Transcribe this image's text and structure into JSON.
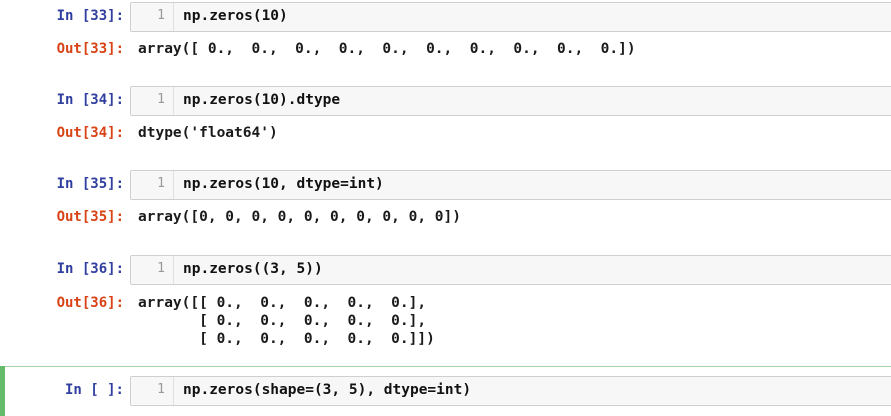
{
  "cells": [
    {
      "in_prompt": "In [33]:",
      "line_number": "1",
      "code": "np.zeros(10)",
      "out_prompt": "Out[33]:",
      "output": "array([ 0.,  0.,  0.,  0.,  0.,  0.,  0.,  0.,  0.,  0.])"
    },
    {
      "in_prompt": "In [34]:",
      "line_number": "1",
      "code": "np.zeros(10).dtype",
      "out_prompt": "Out[34]:",
      "output": "dtype('float64')"
    },
    {
      "in_prompt": "In [35]:",
      "line_number": "1",
      "code": "np.zeros(10, dtype=int)",
      "out_prompt": "Out[35]:",
      "output": "array([0, 0, 0, 0, 0, 0, 0, 0, 0, 0])"
    },
    {
      "in_prompt": "In [36]:",
      "line_number": "1",
      "code": "np.zeros((3, 5))",
      "out_prompt": "Out[36]:",
      "output": "array([[ 0.,  0.,  0.,  0.,  0.],\n       [ 0.,  0.,  0.,  0.,  0.],\n       [ 0.,  0.,  0.,  0.,  0.]])"
    },
    {
      "in_prompt": "In [ ]:",
      "line_number": "1",
      "code": "np.zeros(shape=(3, 5), dtype=int)"
    }
  ],
  "colors": {
    "in_prompt": "#303f9f",
    "out_prompt": "#d84315",
    "number": "#2e7d32",
    "active_cell": "#66bb6a"
  }
}
